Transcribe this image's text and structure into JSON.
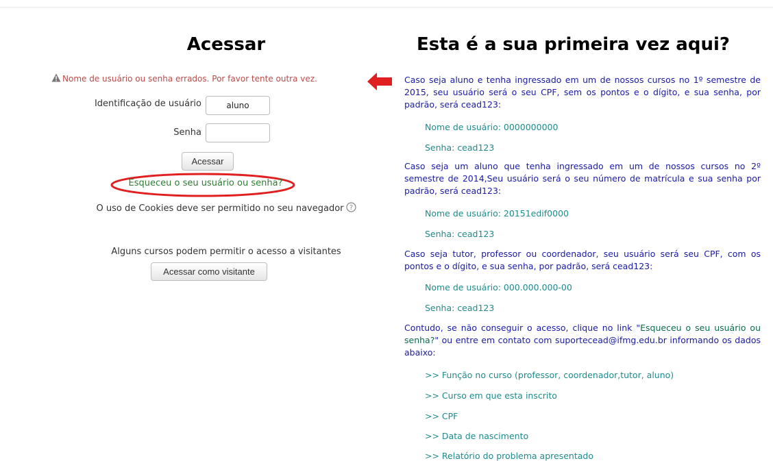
{
  "login": {
    "title": "Acessar",
    "error": "Nome de usuário ou senha errados. Por favor tente outra vez.",
    "username_label": "Identificação de usuário",
    "username_value": "aluno",
    "password_label": "Senha",
    "password_value": "",
    "login_button": "Acessar",
    "forgot_link": "Esqueceu o seu usuário ou senha?",
    "cookies_text": "O uso de Cookies deve ser permitido no seu navegador",
    "guests_text": "Alguns cursos podem permitir o acesso a visitantes",
    "guest_button": "Acessar como visitante"
  },
  "info": {
    "title": "Esta é a sua primeira vez aqui?",
    "para1": "Caso seja aluno e tenha ingressado em um de nossos cursos no 1º semestre de 2015, seu usuário será o seu CPF, sem os pontos e o dígito, e sua senha, por padrão, será cead123:",
    "p1_user": "Nome de usuário: 0000000000",
    "p1_pass": "Senha: cead123",
    "para2": "Caso seja um aluno que tenha ingressado em um de nossos cursos no 2º semestre de 2014,Seu usuário será o seu número de matrícula e sua senha por padrão, será cead123:",
    "p2_user": "Nome de usuário: 20151edif0000",
    "p2_pass": "Senha: cead123",
    "para3": "Caso seja tutor, professor ou coordenador, seu usuário será seu CPF, com os pontos e o dígito, e sua senha, por padrão, será cead123:",
    "p3_user": "Nome de usuário: 000.000.000-00",
    "p3_pass": "Senha: cead123",
    "para4_a": "Contudo, se não conseguir o acesso, clique no link \"",
    "para4_link": "Esqueceu o seu usuário ou senha?",
    "para4_b": "\" ou entre em contato com suportecead@ifmg.edu.br informando os dados abaixo:",
    "items": [
      ">> Função no curso (professor, coordenador,tutor, aluno)",
      ">> Curso em que esta inscrito",
      ">> CPF",
      ">> Data de nascimento",
      ">> Relatório do problema apresentado"
    ]
  },
  "colors": {
    "error": "#b94a48",
    "link_green": "#2e7d32",
    "info_blue": "#1a1aa6",
    "info_teal": "#1f8a8a",
    "annotation_red": "#e02020"
  },
  "icons": [
    "warning-icon",
    "red-arrow-icon",
    "red-ellipse-annotation",
    "help-icon"
  ]
}
